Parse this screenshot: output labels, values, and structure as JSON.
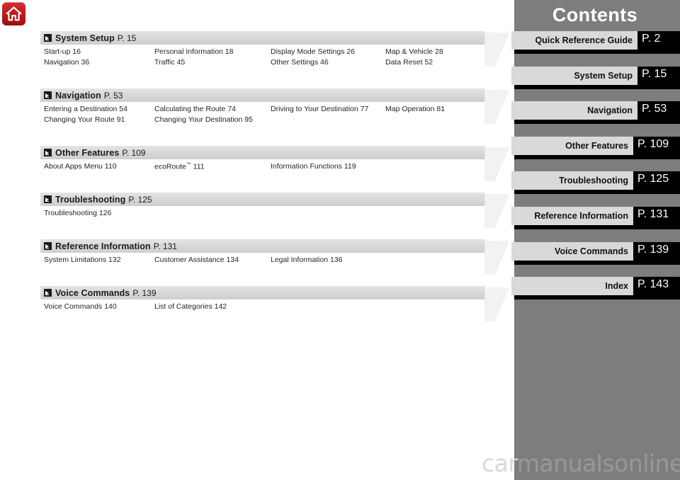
{
  "home_button": {
    "icon": "home-icon"
  },
  "sidebar": {
    "title": "Contents",
    "tabs": [
      {
        "label": "Quick Reference Guide",
        "page": "P. 2"
      },
      {
        "label": "System Setup",
        "page": "P. 15"
      },
      {
        "label": "Navigation",
        "page": "P. 53"
      },
      {
        "label": "Other Features",
        "page": "P. 109"
      },
      {
        "label": "Troubleshooting",
        "page": "P. 125"
      },
      {
        "label": "Reference Information",
        "page": "P. 131"
      },
      {
        "label": "Voice Commands",
        "page": "P. 139"
      },
      {
        "label": "Index",
        "page": "P. 143"
      }
    ]
  },
  "toc": {
    "sections": [
      {
        "title": "System Setup",
        "page": "P. 15",
        "rows": [
          [
            "Start-up 16",
            "Personal Information 18",
            "Display Mode Settings 26",
            "Map & Vehicle 28"
          ],
          [
            "Navigation 36",
            "Traffic 45",
            "Other Settings 46",
            "Data Reset 52"
          ]
        ]
      },
      {
        "title": "Navigation",
        "page": "P. 53",
        "rows": [
          [
            "Entering a Destination 54",
            "Calculating the Route 74",
            "Driving to Your Destination 77",
            "Map Operation 81"
          ],
          [
            "Changing Your Route 91",
            "Changing Your Destination 95"
          ]
        ]
      },
      {
        "title": "Other Features",
        "page": "P. 109",
        "rows": [
          [
            "About Apps Menu 110",
            "ecoRoute™ 111",
            "Information Functions 119"
          ]
        ]
      },
      {
        "title": "Troubleshooting",
        "page": "P. 125",
        "rows": [
          [
            "Troubleshooting 126"
          ]
        ]
      },
      {
        "title": "Reference Information",
        "page": "P. 131",
        "rows": [
          [
            "System Limitations 132",
            "Customer Assistance 134",
            "Legal Information 136"
          ]
        ]
      },
      {
        "title": "Voice Commands",
        "page": "P. 139",
        "rows": [
          [
            "Voice Commands 140",
            "List of Categories 142"
          ]
        ]
      }
    ]
  },
  "watermark": {
    "part_white": "car",
    "part_gray": "manualsonline.info"
  }
}
